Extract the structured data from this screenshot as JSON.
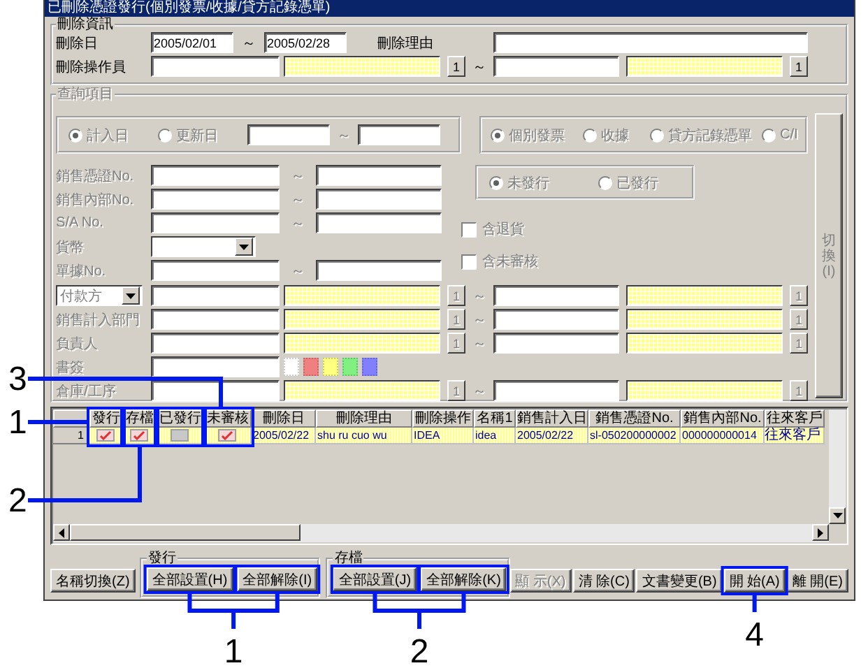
{
  "window": {
    "title": "已刪除憑證發行(個別發票/收據/貸方記錄憑單)"
  },
  "delete_info": {
    "title": "刪除資訊",
    "date": {
      "label": "刪除日",
      "from": "2005/02/01",
      "separator": "～",
      "to": "2005/02/28"
    },
    "reason": {
      "label": "刪除理由"
    },
    "operator": {
      "label": "刪除操作員",
      "from_button": "1",
      "separator": "～",
      "to_button": "1"
    }
  },
  "query": {
    "title": "查詢項目",
    "disabled": true,
    "date_type": [
      {
        "label": "計入日",
        "selected": true
      },
      {
        "label": "更新日",
        "selected": false
      }
    ],
    "date_separator": "～",
    "document_type": [
      {
        "label": "個別發票",
        "selected": true
      },
      {
        "label": "收據",
        "selected": false
      },
      {
        "label": "貸方記錄憑單",
        "selected": false
      },
      {
        "label": "C/I",
        "selected": false
      }
    ],
    "range_rows": [
      {
        "kind": "range",
        "label": "銷售憑證No.",
        "separator": "～"
      },
      {
        "kind": "range",
        "label": "銷售內部No.",
        "separator": "～"
      },
      {
        "kind": "range",
        "label": "S/A No.",
        "separator": "～"
      },
      {
        "kind": "select",
        "label": "貨幣"
      },
      {
        "kind": "range",
        "label": "單據No.",
        "separator": "～"
      }
    ],
    "issue_status": [
      {
        "label": "未發行",
        "selected": true
      },
      {
        "label": "已發行",
        "selected": false
      }
    ],
    "options": [
      {
        "label": "含退貨",
        "checked": false
      },
      {
        "label": "含未審核",
        "checked": false
      }
    ],
    "lookup_rows": [
      {
        "kind": "lookup_select",
        "label": "付款方",
        "from_button": "1",
        "separator": "～",
        "to_button": "1"
      },
      {
        "kind": "lookup",
        "label": "銷售計入部門",
        "from_button": "1",
        "separator": "～",
        "to_button": "1"
      },
      {
        "kind": "lookup",
        "label": "負責人",
        "from_button": "1",
        "separator": "～",
        "to_button": "1"
      },
      {
        "kind": "bookmark",
        "label": "書簽",
        "swatches": [
          {
            "color": "#ffffff"
          },
          {
            "color": "#f08080"
          },
          {
            "color": "#ffff80"
          },
          {
            "color": "#80f080"
          },
          {
            "color": "#8080ff"
          }
        ]
      },
      {
        "kind": "lookup",
        "label": "倉庫/工序",
        "from_button": "1",
        "separator": "～",
        "to_button": "1"
      }
    ],
    "switch_button": "切換(I)"
  },
  "grid": {
    "columns": [
      "發行",
      "存檔",
      "已發行",
      "未審核",
      "刪除日",
      "刪除理由",
      "刪除操作",
      "名稱1",
      "銷售計入日",
      "銷售憑證No.",
      "銷售內部No.",
      "往來客戶"
    ],
    "rows": [
      {
        "number": "1",
        "selected": true,
        "cells": [
          {
            "kind": "flag",
            "checked": true
          },
          {
            "kind": "flag",
            "checked": true
          },
          {
            "kind": "flag",
            "checked": false
          },
          {
            "kind": "flag",
            "checked": true
          },
          {
            "kind": "text",
            "text": "2005/02/22"
          },
          {
            "kind": "text",
            "text": "shu ru cuo wu"
          },
          {
            "kind": "text",
            "text": "IDEA"
          },
          {
            "kind": "text",
            "text": "idea"
          },
          {
            "kind": "text",
            "text": "2005/02/22"
          },
          {
            "kind": "text",
            "text": "sl-050200000002"
          },
          {
            "kind": "text",
            "text": "000000000014"
          },
          {
            "kind": "text",
            "text": "往來客戶"
          }
        ]
      }
    ]
  },
  "footer": {
    "rename_button": "名稱切換(Z)",
    "issue_group": {
      "title": "發行",
      "buttons": [
        "全部設置(H)",
        "全部解除(I)"
      ]
    },
    "archive_group": {
      "title": "存檔",
      "buttons": [
        "全部設置(J)",
        "全部解除(K)"
      ]
    },
    "actions": [
      {
        "label": "顯 示(X)",
        "disabled": true
      },
      {
        "label": "清 除(C)",
        "disabled": false
      },
      {
        "label": "文書變更(B)",
        "disabled": false
      },
      {
        "label": "開 始(A)",
        "disabled": false
      },
      {
        "label": "離 開(E)",
        "disabled": false
      }
    ]
  },
  "callouts": [
    {
      "number": "3"
    },
    {
      "number": "1"
    },
    {
      "number": "2"
    },
    {
      "number": "1"
    },
    {
      "number": "2"
    },
    {
      "number": "4"
    }
  ]
}
